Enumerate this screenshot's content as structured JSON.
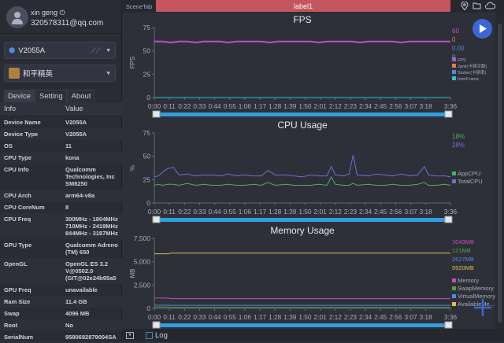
{
  "user": {
    "name": "xin geng",
    "email": "320578311@qq.com"
  },
  "device_select": {
    "value": "V2055A"
  },
  "app_select": {
    "value": "和平精英"
  },
  "tabs": [
    "Device",
    "Setting",
    "About"
  ],
  "info": {
    "headers": [
      "Info",
      "Value"
    ],
    "rows": [
      [
        "Device Name",
        "V2055A"
      ],
      [
        "Device Type",
        "V2055A"
      ],
      [
        "OS",
        "11"
      ],
      [
        "CPU Type",
        "kona"
      ],
      [
        "CPU Info",
        "Qualcomm\nTechnologies, Inc\nSM8250"
      ],
      [
        "CPU Arch",
        "arm64-v8a"
      ],
      [
        "CPU CoreNum",
        "8"
      ],
      [
        "CPU Freq",
        "300MHz - 1804MHz\n710MHz - 2419MHz\n844MHz - 3187MHz"
      ],
      [
        "GPU Type",
        "Qualcomm Adreno\n(TM) 650"
      ],
      [
        "OpenGL",
        "OpenGL ES 3.2\nV@0502.0\n(GIT@02e24b95a5"
      ],
      [
        "GPU Freq",
        "unavailable"
      ],
      [
        "Ram Size",
        "11.4 GB"
      ],
      [
        "Swap",
        "4096 MB"
      ],
      [
        "Root",
        "No"
      ],
      [
        "SerialNum",
        "9580692879004SA"
      ]
    ]
  },
  "topbar": {
    "scene_tab": "SceneTab",
    "label": "label1",
    "icons": [
      "location-pin-icon",
      "folder-icon",
      "cloud-icon"
    ]
  },
  "bottom": {
    "log_label": "Log",
    "log_checked": false
  },
  "colors": {
    "accent": "#3e66d4",
    "label_bar": "#c4565f",
    "timeline": "#2f9fe0"
  },
  "chart_data": [
    {
      "type": "line",
      "title": "FPS",
      "ylabel": "FPS",
      "ylim": [
        0,
        75
      ],
      "yticks": [
        "0",
        "25",
        "50",
        "75"
      ],
      "xticks": [
        "0:00",
        "0:11",
        "0:22",
        "0:33",
        "0:44",
        "0:55",
        "1:06",
        "1:17",
        "1:28",
        "1:39",
        "1:50",
        "2:01",
        "2:12",
        "2:23",
        "2:34",
        "2:45",
        "2:56",
        "3:07",
        "3:18",
        "3:36"
      ],
      "x_seconds": [
        0,
        6,
        12,
        18,
        24,
        30,
        36,
        42,
        48,
        54,
        60,
        66,
        72,
        78,
        84,
        90,
        96,
        102,
        108,
        114,
        120,
        126,
        132,
        138,
        144,
        150,
        156,
        162,
        168,
        174,
        180,
        186,
        192,
        198,
        204,
        210,
        216
      ],
      "series": [
        {
          "name": "FPS",
          "color": "#c050c0",
          "current": "60",
          "values": [
            60,
            60,
            59,
            60,
            60,
            59,
            60,
            60,
            60,
            59,
            60,
            60,
            60,
            60,
            59,
            60,
            60,
            60,
            60,
            60,
            59,
            60,
            60,
            60,
            60,
            59,
            60,
            60,
            60,
            60,
            59,
            60,
            60,
            60,
            60,
            60,
            60
          ]
        },
        {
          "name": "Jank(卡顿次数)",
          "color": "#e0803a",
          "current": "0",
          "values": [
            0,
            0,
            0,
            0,
            0,
            0,
            0,
            0,
            0,
            0,
            0,
            0,
            0,
            0,
            0,
            0,
            0,
            0,
            0,
            0,
            0,
            0,
            0,
            0,
            0,
            0,
            0,
            0,
            0,
            0,
            0,
            0,
            0,
            0,
            0,
            0,
            0
          ]
        },
        {
          "name": "Stutter(卡顿率)",
          "color": "#4a8ce0",
          "current": "0.00",
          "values": [
            0,
            0,
            0,
            0,
            0,
            0,
            0,
            0,
            0,
            0,
            0,
            0,
            0,
            0,
            0,
            0,
            0,
            0,
            0,
            0,
            0,
            0,
            0,
            0,
            0,
            0,
            0,
            0,
            0,
            0,
            0,
            0,
            0,
            0,
            0,
            0,
            0
          ]
        },
        {
          "name": "InterFrame",
          "color": "#30c0c8",
          "current": "0",
          "values": [
            0,
            0,
            0,
            0,
            0,
            0,
            0,
            0,
            0,
            0,
            0,
            0,
            0,
            0,
            0,
            0,
            0,
            0,
            0,
            0,
            0,
            0,
            0,
            0,
            0,
            0,
            0,
            0,
            0,
            0,
            0,
            0,
            0,
            0,
            0,
            0,
            0
          ]
        }
      ]
    },
    {
      "type": "line",
      "title": "CPU Usage",
      "ylabel": "%",
      "ylim": [
        0,
        75
      ],
      "yticks": [
        "0",
        "25",
        "50",
        "75"
      ],
      "xticks": [
        "0:00",
        "0:11",
        "0:22",
        "0:33",
        "0:44",
        "0:55",
        "1:06",
        "1:17",
        "1:28",
        "1:39",
        "1:50",
        "2:01",
        "2:12",
        "2:23",
        "2:34",
        "2:45",
        "2:56",
        "3:07",
        "3:18",
        "3:36"
      ],
      "x_seconds": [
        0,
        3,
        6,
        10,
        14,
        18,
        24,
        30,
        36,
        42,
        48,
        54,
        60,
        66,
        72,
        78,
        83,
        88,
        96,
        102,
        108,
        114,
        120,
        126,
        129,
        132,
        138,
        142,
        145,
        148,
        156,
        162,
        168,
        174,
        180,
        186,
        192,
        197,
        200,
        206,
        212,
        216
      ],
      "series": [
        {
          "name": "AppCPU",
          "color": "#4caf60",
          "current": "18%",
          "values": [
            19,
            20,
            19,
            20,
            20,
            19,
            21,
            19,
            20,
            19,
            19,
            20,
            19,
            19,
            20,
            19,
            22,
            19,
            20,
            19,
            19,
            19,
            20,
            19,
            28,
            20,
            19,
            19,
            21,
            19,
            20,
            19,
            19,
            20,
            19,
            19,
            20,
            22,
            19,
            19,
            20,
            19
          ]
        },
        {
          "name": "TotalCPU",
          "color": "#6a72d0",
          "current": "28%",
          "values": [
            28,
            29,
            33,
            37,
            38,
            30,
            31,
            29,
            30,
            30,
            29,
            31,
            29,
            30,
            29,
            29,
            35,
            30,
            30,
            29,
            28,
            30,
            29,
            29,
            39,
            30,
            29,
            31,
            51,
            30,
            29,
            31,
            30,
            29,
            31,
            29,
            30,
            39,
            30,
            29,
            29,
            28
          ]
        }
      ]
    },
    {
      "type": "line",
      "title": "Memory Usage",
      "ylabel": "MB",
      "ylim": [
        0,
        7500
      ],
      "yticks": [
        "0",
        "2,500",
        "5,000",
        "7,500"
      ],
      "xticks": [
        "0:00",
        "0:11",
        "0:22",
        "0:33",
        "0:44",
        "0:55",
        "1:06",
        "1:17",
        "1:28",
        "1:39",
        "1:50",
        "2:01",
        "2:12",
        "2:23",
        "2:34",
        "2:45",
        "2:56",
        "3:07",
        "3:18",
        "3:36"
      ],
      "x_seconds": [
        0,
        10,
        12,
        216
      ],
      "series": [
        {
          "name": "Memory",
          "color": "#c050c0",
          "current": "1043MB",
          "values": [
            1100,
            1100,
            1043,
            1043
          ]
        },
        {
          "name": "SwapMemory",
          "color": "#5aa040",
          "current": "121MB",
          "values": [
            150,
            150,
            121,
            121
          ]
        },
        {
          "name": "VirtualMemory",
          "color": "#4a8ce0",
          "current": "2627MB",
          "values": [
            340,
            340,
            330,
            330
          ]
        },
        {
          "name": "AvailableMe...",
          "color": "#e0c040",
          "current": "5920MB",
          "values": [
            5850,
            5850,
            5920,
            5920
          ]
        }
      ]
    }
  ]
}
